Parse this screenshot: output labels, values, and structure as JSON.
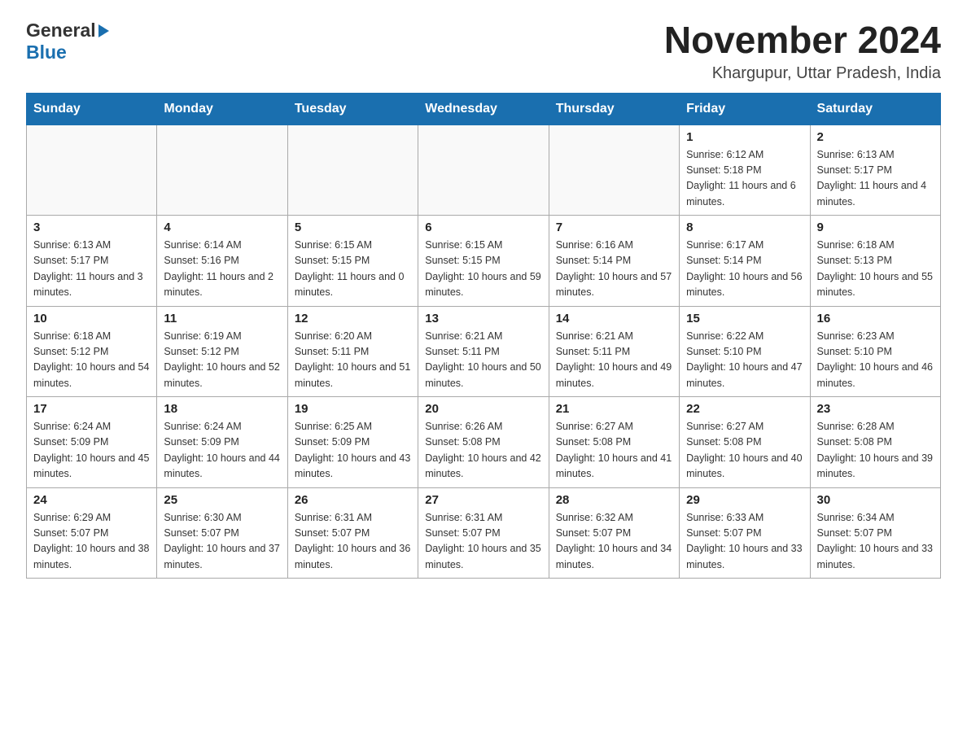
{
  "header": {
    "logo_general": "General",
    "logo_blue": "Blue",
    "month_title": "November 2024",
    "location": "Khargupur, Uttar Pradesh, India"
  },
  "days_of_week": [
    "Sunday",
    "Monday",
    "Tuesday",
    "Wednesday",
    "Thursday",
    "Friday",
    "Saturday"
  ],
  "weeks": [
    [
      {
        "day": "",
        "info": ""
      },
      {
        "day": "",
        "info": ""
      },
      {
        "day": "",
        "info": ""
      },
      {
        "day": "",
        "info": ""
      },
      {
        "day": "",
        "info": ""
      },
      {
        "day": "1",
        "info": "Sunrise: 6:12 AM\nSunset: 5:18 PM\nDaylight: 11 hours and 6 minutes."
      },
      {
        "day": "2",
        "info": "Sunrise: 6:13 AM\nSunset: 5:17 PM\nDaylight: 11 hours and 4 minutes."
      }
    ],
    [
      {
        "day": "3",
        "info": "Sunrise: 6:13 AM\nSunset: 5:17 PM\nDaylight: 11 hours and 3 minutes."
      },
      {
        "day": "4",
        "info": "Sunrise: 6:14 AM\nSunset: 5:16 PM\nDaylight: 11 hours and 2 minutes."
      },
      {
        "day": "5",
        "info": "Sunrise: 6:15 AM\nSunset: 5:15 PM\nDaylight: 11 hours and 0 minutes."
      },
      {
        "day": "6",
        "info": "Sunrise: 6:15 AM\nSunset: 5:15 PM\nDaylight: 10 hours and 59 minutes."
      },
      {
        "day": "7",
        "info": "Sunrise: 6:16 AM\nSunset: 5:14 PM\nDaylight: 10 hours and 57 minutes."
      },
      {
        "day": "8",
        "info": "Sunrise: 6:17 AM\nSunset: 5:14 PM\nDaylight: 10 hours and 56 minutes."
      },
      {
        "day": "9",
        "info": "Sunrise: 6:18 AM\nSunset: 5:13 PM\nDaylight: 10 hours and 55 minutes."
      }
    ],
    [
      {
        "day": "10",
        "info": "Sunrise: 6:18 AM\nSunset: 5:12 PM\nDaylight: 10 hours and 54 minutes."
      },
      {
        "day": "11",
        "info": "Sunrise: 6:19 AM\nSunset: 5:12 PM\nDaylight: 10 hours and 52 minutes."
      },
      {
        "day": "12",
        "info": "Sunrise: 6:20 AM\nSunset: 5:11 PM\nDaylight: 10 hours and 51 minutes."
      },
      {
        "day": "13",
        "info": "Sunrise: 6:21 AM\nSunset: 5:11 PM\nDaylight: 10 hours and 50 minutes."
      },
      {
        "day": "14",
        "info": "Sunrise: 6:21 AM\nSunset: 5:11 PM\nDaylight: 10 hours and 49 minutes."
      },
      {
        "day": "15",
        "info": "Sunrise: 6:22 AM\nSunset: 5:10 PM\nDaylight: 10 hours and 47 minutes."
      },
      {
        "day": "16",
        "info": "Sunrise: 6:23 AM\nSunset: 5:10 PM\nDaylight: 10 hours and 46 minutes."
      }
    ],
    [
      {
        "day": "17",
        "info": "Sunrise: 6:24 AM\nSunset: 5:09 PM\nDaylight: 10 hours and 45 minutes."
      },
      {
        "day": "18",
        "info": "Sunrise: 6:24 AM\nSunset: 5:09 PM\nDaylight: 10 hours and 44 minutes."
      },
      {
        "day": "19",
        "info": "Sunrise: 6:25 AM\nSunset: 5:09 PM\nDaylight: 10 hours and 43 minutes."
      },
      {
        "day": "20",
        "info": "Sunrise: 6:26 AM\nSunset: 5:08 PM\nDaylight: 10 hours and 42 minutes."
      },
      {
        "day": "21",
        "info": "Sunrise: 6:27 AM\nSunset: 5:08 PM\nDaylight: 10 hours and 41 minutes."
      },
      {
        "day": "22",
        "info": "Sunrise: 6:27 AM\nSunset: 5:08 PM\nDaylight: 10 hours and 40 minutes."
      },
      {
        "day": "23",
        "info": "Sunrise: 6:28 AM\nSunset: 5:08 PM\nDaylight: 10 hours and 39 minutes."
      }
    ],
    [
      {
        "day": "24",
        "info": "Sunrise: 6:29 AM\nSunset: 5:07 PM\nDaylight: 10 hours and 38 minutes."
      },
      {
        "day": "25",
        "info": "Sunrise: 6:30 AM\nSunset: 5:07 PM\nDaylight: 10 hours and 37 minutes."
      },
      {
        "day": "26",
        "info": "Sunrise: 6:31 AM\nSunset: 5:07 PM\nDaylight: 10 hours and 36 minutes."
      },
      {
        "day": "27",
        "info": "Sunrise: 6:31 AM\nSunset: 5:07 PM\nDaylight: 10 hours and 35 minutes."
      },
      {
        "day": "28",
        "info": "Sunrise: 6:32 AM\nSunset: 5:07 PM\nDaylight: 10 hours and 34 minutes."
      },
      {
        "day": "29",
        "info": "Sunrise: 6:33 AM\nSunset: 5:07 PM\nDaylight: 10 hours and 33 minutes."
      },
      {
        "day": "30",
        "info": "Sunrise: 6:34 AM\nSunset: 5:07 PM\nDaylight: 10 hours and 33 minutes."
      }
    ]
  ]
}
